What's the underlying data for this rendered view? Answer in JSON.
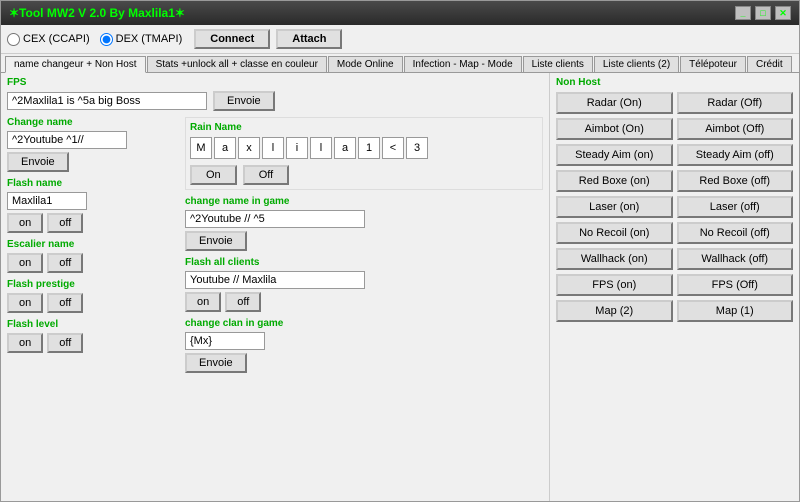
{
  "titleBar": {
    "title": "✶Tool MW2 V 2.0  By Maxlila1✶",
    "controls": [
      "_",
      "□",
      "✕"
    ]
  },
  "connectionRow": {
    "cex_label": "CEX (CCAPI)",
    "dex_label": "DEX (TMAPI)",
    "connect_btn": "Connect",
    "attach_btn": "Attach"
  },
  "tabs": [
    {
      "label": "name changeur + Non Host",
      "active": true
    },
    {
      "label": "Stats +unlock all + classe en couleur",
      "active": false
    },
    {
      "label": "Mode Online",
      "active": false
    },
    {
      "label": "Infection - Map - Mode",
      "active": false
    },
    {
      "label": "Liste clients",
      "active": false
    },
    {
      "label": "Liste clients (2)",
      "active": false
    },
    {
      "label": "Télépoteur",
      "active": false
    },
    {
      "label": "Crédit",
      "active": false
    }
  ],
  "fps": {
    "label": "FPS",
    "input_value": "^2Maxlila1 is ^5a big Boss",
    "envoie_btn": "Envoie"
  },
  "changeName": {
    "label": "Change name",
    "input_value": "^2Youtube ^1//",
    "envoie_btn": "Envoie"
  },
  "rainName": {
    "label": "Rain Name",
    "chars": [
      "M",
      "a",
      "x",
      "l",
      "i",
      "l",
      "a",
      "1",
      "<",
      "3"
    ],
    "on_btn": "On",
    "off_btn": "Off"
  },
  "flashName": {
    "label": "Flash name",
    "input_value": "Maxlila1",
    "on_btn": "on",
    "off_btn": "off"
  },
  "escalierName": {
    "label": "Escalier name",
    "on_btn": "on",
    "off_btn": "off"
  },
  "flashPrestige": {
    "label": "Flash prestige",
    "on_btn": "on",
    "off_btn": "off"
  },
  "flashLevel": {
    "label": "Flash level",
    "on_btn": "on",
    "off_btn": "off"
  },
  "changeNameInGame": {
    "label": "change name in game",
    "input_value": "^2Youtube // ^5",
    "envoie_btn": "Envoie"
  },
  "flashAllClients": {
    "label": "Flash all clients",
    "input_value": "Youtube // Maxlila",
    "on_btn": "on",
    "off_btn": "off"
  },
  "changeClanInGame": {
    "label": "change clan in game",
    "input_value": "{Mx}",
    "envoie_btn": "Envoie"
  },
  "nonHost": {
    "label": "Non Host",
    "buttons": [
      {
        "label": "Radar (On)",
        "col": 0,
        "row": 0
      },
      {
        "label": "Radar (Off)",
        "col": 1,
        "row": 0
      },
      {
        "label": "Aimbot (On)",
        "col": 0,
        "row": 1
      },
      {
        "label": "Aimbot (Off)",
        "col": 1,
        "row": 1
      },
      {
        "label": "Steady Aim (on)",
        "col": 0,
        "row": 2
      },
      {
        "label": "Steady Aim (off)",
        "col": 1,
        "row": 2
      },
      {
        "label": "Red Boxe (on)",
        "col": 0,
        "row": 3
      },
      {
        "label": "Red Boxe (off)",
        "col": 1,
        "row": 3
      },
      {
        "label": "Laser (on)",
        "col": 0,
        "row": 4
      },
      {
        "label": "Laser (off)",
        "col": 1,
        "row": 4
      },
      {
        "label": "No Recoil (on)",
        "col": 0,
        "row": 5
      },
      {
        "label": "No Recoil (off)",
        "col": 1,
        "row": 5
      },
      {
        "label": "Wallhack (on)",
        "col": 0,
        "row": 6
      },
      {
        "label": "Wallhack (off)",
        "col": 1,
        "row": 6
      },
      {
        "label": "FPS (on)",
        "col": 0,
        "row": 7
      },
      {
        "label": "FPS (Off)",
        "col": 1,
        "row": 7
      },
      {
        "label": "Map (2)",
        "col": 0,
        "row": 8
      },
      {
        "label": "Map (1)",
        "col": 1,
        "row": 8
      }
    ]
  }
}
